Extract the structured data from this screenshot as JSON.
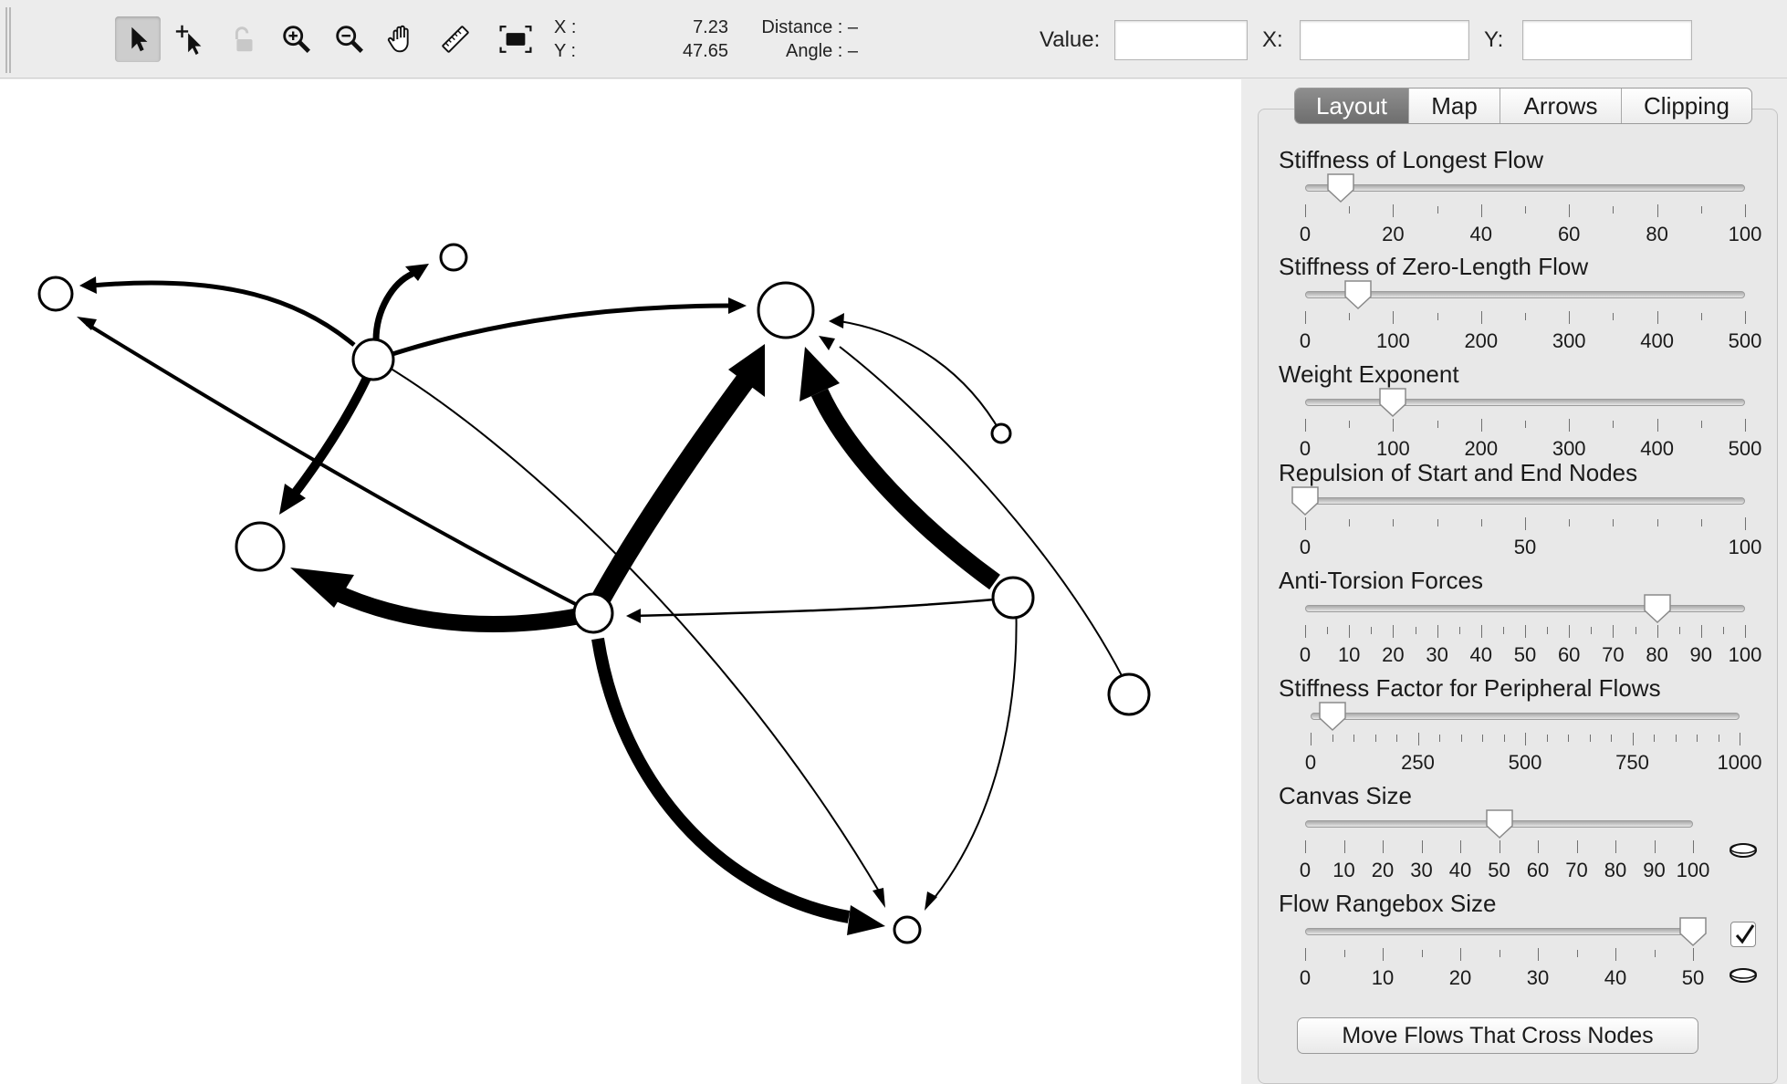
{
  "toolbar": {
    "tools": [
      {
        "name": "select-icon",
        "active": true
      },
      {
        "name": "add-node-icon",
        "active": false
      },
      {
        "name": "lock-icon",
        "active": false,
        "disabled": true
      },
      {
        "name": "zoom-in-icon",
        "active": false
      },
      {
        "name": "zoom-out-icon",
        "active": false
      },
      {
        "name": "pan-hand-icon",
        "active": false
      },
      {
        "name": "measure-ruler-icon",
        "active": false
      },
      {
        "name": "zoom-to-fit-icon",
        "active": false
      }
    ],
    "x_label": "X :",
    "y_label": "Y :",
    "x_value": "7.23",
    "y_value": "47.65",
    "distance": "Distance : –",
    "angle": "Angle : –",
    "value_label": "Value:",
    "value_input": "",
    "xfield_label": "X:",
    "xfield_input": "",
    "yfield_label": "Y:",
    "yfield_input": ""
  },
  "tabs": [
    "Layout",
    "Map",
    "Arrows",
    "Clipping"
  ],
  "selected_tab": "Layout",
  "sliders": [
    {
      "title": "Stiffness of Longest Flow",
      "min": 0,
      "max": 100,
      "value": 8,
      "labels": [
        "0",
        "20",
        "40",
        "60",
        "80",
        "100"
      ],
      "minor_ticks": 10
    },
    {
      "title": "Stiffness of Zero-Length Flow",
      "min": 0,
      "max": 500,
      "value": 60,
      "labels": [
        "0",
        "100",
        "200",
        "300",
        "400",
        "500"
      ],
      "minor_ticks": 10
    },
    {
      "title": "Weight Exponent",
      "min": 0,
      "max": 500,
      "value": 100,
      "labels": [
        "0",
        "100",
        "200",
        "300",
        "400",
        "500"
      ],
      "minor_ticks": 10
    },
    {
      "title": "Repulsion of Start and End Nodes",
      "min": 0,
      "max": 100,
      "value": 0,
      "labels": [
        "0",
        "50",
        "100"
      ],
      "minor_ticks": 10
    },
    {
      "title": "Anti-Torsion Forces",
      "min": 0,
      "max": 100,
      "value": 80,
      "labels": [
        "0",
        "10",
        "20",
        "30",
        "40",
        "50",
        "60",
        "70",
        "80",
        "90",
        "100"
      ],
      "minor_ticks": 20
    },
    {
      "title": "Stiffness Factor for Peripheral Flows",
      "min": 0,
      "max": 1000,
      "value": 50,
      "labels": [
        "0",
        "250",
        "500",
        "750",
        "1000"
      ],
      "minor_ticks": 20
    },
    {
      "title": "Canvas Size",
      "min": 0,
      "max": 100,
      "value": 50,
      "labels": [
        "0",
        "10",
        "20",
        "30",
        "40",
        "50",
        "60",
        "70",
        "80",
        "90",
        "100"
      ],
      "minor_ticks": 10
    },
    {
      "title": "Flow Rangebox Size",
      "min": 0,
      "max": 50,
      "value": 50,
      "labels": [
        "0",
        "10",
        "20",
        "30",
        "40",
        "50"
      ],
      "minor_ticks": 10
    }
  ],
  "rangebox_checked": true,
  "move_button": "Move Flows That Cross Nodes"
}
